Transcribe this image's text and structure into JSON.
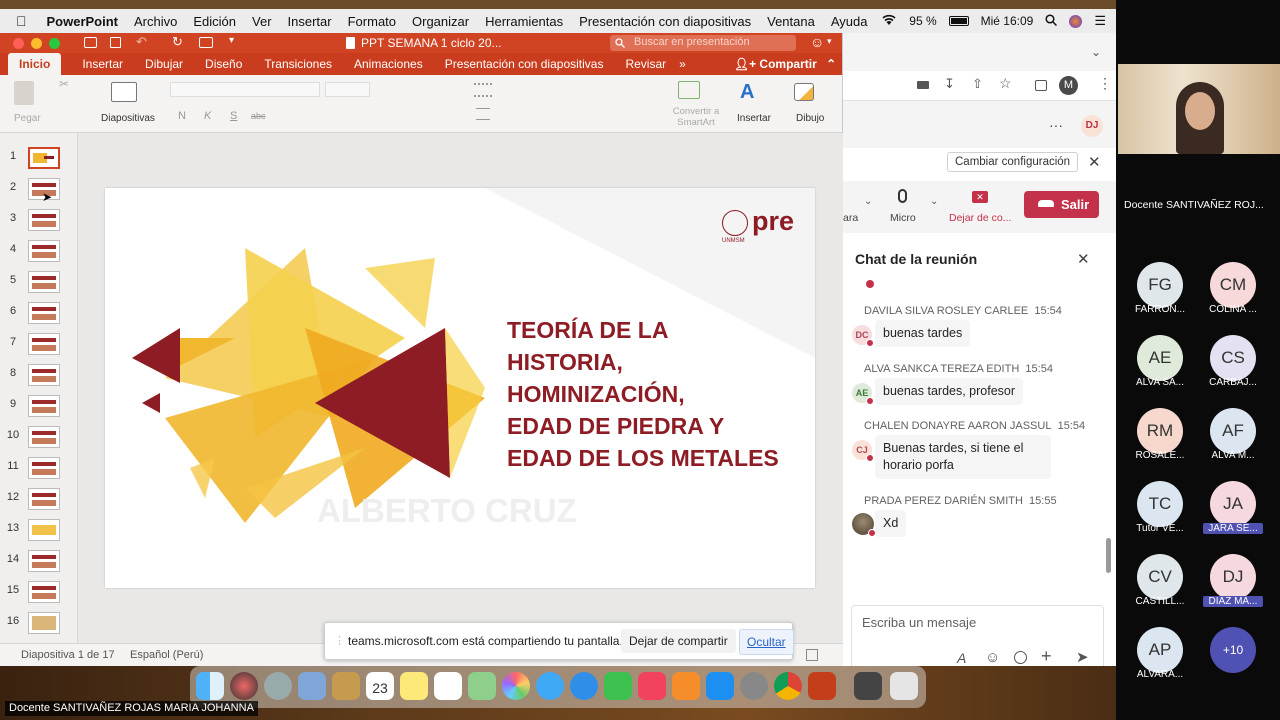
{
  "menubar": {
    "app_name": "PowerPoint",
    "items": [
      "Archivo",
      "Edición",
      "Ver",
      "Insertar",
      "Formato",
      "Organizar",
      "Herramientas",
      "Presentación con diapositivas",
      "Ventana",
      "Ayuda"
    ],
    "battery": "95 %",
    "datetime": "Mié 16:09"
  },
  "ppt": {
    "doc_title": "PPT SEMANA 1 ciclo 20...",
    "search_placeholder": "Buscar en presentación",
    "tabs": [
      "Inicio",
      "Insertar",
      "Dibujar",
      "Diseño",
      "Transiciones",
      "Animaciones",
      "Presentación con diapositivas",
      "Revisar"
    ],
    "share_label": "Compartir",
    "ribbon": {
      "paste": "Pegar",
      "slides": "Diapositivas",
      "convert": "Convertir a SmartArt",
      "insert": "Insertar",
      "draw": "Dibujo"
    },
    "slide_numbers": [
      "1",
      "2",
      "3",
      "4",
      "5",
      "6",
      "7",
      "8",
      "9",
      "10",
      "11",
      "12",
      "13",
      "14",
      "15",
      "16"
    ],
    "slide": {
      "logo_text": "pre",
      "logo_sub": "UNMSM",
      "title_lines": [
        "TEORÍA DE LA",
        "HISTORIA,",
        "HOMINIZACIÓN,",
        "EDAD DE PIEDRA Y",
        "EDAD DE LOS METALES"
      ],
      "author": "ALBERTO CRUZ"
    },
    "status": {
      "slide_info": "Diapositiva 1 de 17",
      "language": "Español (Perú)"
    }
  },
  "share_banner": {
    "message": "teams.microsoft.com está compartiendo tu pantalla.",
    "stop_label": "Dejar de compartir",
    "hide_label": "Ocultar"
  },
  "teams": {
    "profile_initial": "M",
    "user_badge": "DJ",
    "settings_button": "Cambiar configuración",
    "controls": {
      "camera": "ara",
      "mic": "Micro",
      "stop_share": "Dejar de co...",
      "leave": "Salir"
    },
    "chat_title": "Chat de la reunión",
    "messages": [
      {
        "name": "DAVILA SILVA ROSLEY CARLEE",
        "time": "15:54",
        "initials": "DC",
        "text": "buenas tardes"
      },
      {
        "name": "ALVA SANKCA TEREZA EDITH",
        "time": "15:54",
        "initials": "AE",
        "text": "buenas tardes, profesor"
      },
      {
        "name": "CHALEN DONAYRE AARON JASSUL",
        "time": "15:54",
        "initials": "CJ",
        "text_lines": [
          "Buenas tardes, si tiene el",
          "horario porfa"
        ]
      },
      {
        "name": "PRADA PEREZ DARIÉN SMITH",
        "time": "15:55",
        "initials": "",
        "text": "Xd"
      }
    ],
    "compose_placeholder": "Escriba un mensaje"
  },
  "dock": {
    "calendar_day": "23"
  },
  "video": {
    "presenter_name": "Docente SANTIVAÑEZ ROJ...",
    "bottom_name": "Docente SANTIVAÑEZ ROJAS MARIA JOHANNA"
  },
  "participants": [
    {
      "initials": "FG",
      "label": "FARROÑ...",
      "color": "#dfe7ea",
      "highlight": false
    },
    {
      "initials": "CM",
      "label": "COLINA ...",
      "color": "#f7d9d9",
      "highlight": false
    },
    {
      "initials": "AE",
      "label": "ALVA SA...",
      "color": "#dfeadb",
      "highlight": false
    },
    {
      "initials": "CS",
      "label": "CARBAJ...",
      "color": "#e4e2f2",
      "highlight": false
    },
    {
      "initials": "RM",
      "label": "ROSALE...",
      "color": "#f7d8cc",
      "highlight": false
    },
    {
      "initials": "AF",
      "label": "ALVA M...",
      "color": "#dbe6f1",
      "highlight": false
    },
    {
      "initials": "TC",
      "label": "Tutor VE...",
      "color": "#dbe6f1",
      "highlight": false
    },
    {
      "initials": "JA",
      "label": "JARA SE...",
      "color": "#f5d9df",
      "highlight": true
    },
    {
      "initials": "CV",
      "label": "CASTILL...",
      "color": "#dfe7ea",
      "highlight": false
    },
    {
      "initials": "DJ",
      "label": "DIAZ MA...",
      "color": "#f5d9df",
      "highlight": true
    },
    {
      "initials": "AP",
      "label": "ALVARA...",
      "color": "#dbe6f1",
      "highlight": false
    },
    {
      "initials": "+10",
      "label": "",
      "color": "#4f52b2",
      "highlight": false
    }
  ]
}
